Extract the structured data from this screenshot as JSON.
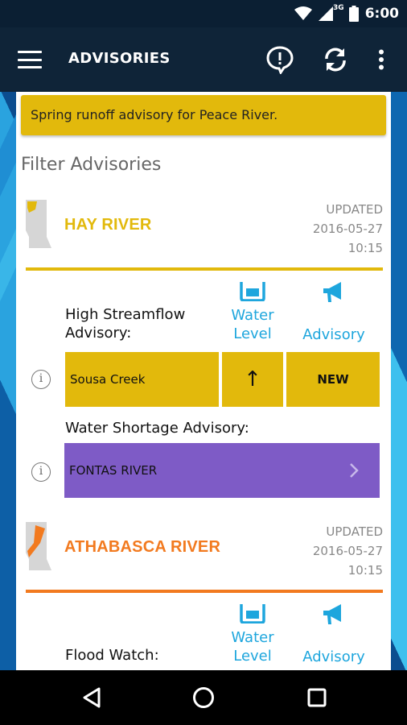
{
  "status_bar": {
    "time": "6:00",
    "network": "3G"
  },
  "app_bar": {
    "title": "ADVISORIES"
  },
  "banner": {
    "text": "Spring runoff advisory for Peace River."
  },
  "filter_heading": "Filter Advisories",
  "columns": {
    "water_level": "Water\nLevel",
    "advisory": "Advisory"
  },
  "rivers": [
    {
      "name": "HAY RIVER",
      "color": "#e2b90c",
      "updated_label": "UPDATED",
      "updated_date": "2016-05-27",
      "updated_time": "10:15",
      "advisories": [
        {
          "type": "High Streamflow\nAdvisory:",
          "station": "Sousa Creek",
          "trend": "↑",
          "status": "NEW"
        },
        {
          "type": "Water Shortage Advisory:",
          "station": "FONTAS RIVER",
          "color": "#7e5bc6"
        }
      ]
    },
    {
      "name": "ATHABASCA RIVER",
      "color": "#f27a1f",
      "updated_label": "UPDATED",
      "updated_date": "2016-05-27",
      "updated_time": "10:15",
      "advisories": [
        {
          "type": "Flood Watch:"
        }
      ]
    }
  ],
  "colors": {
    "accent_blue": "#1ea6dd",
    "app_bar": "#0f2438"
  }
}
